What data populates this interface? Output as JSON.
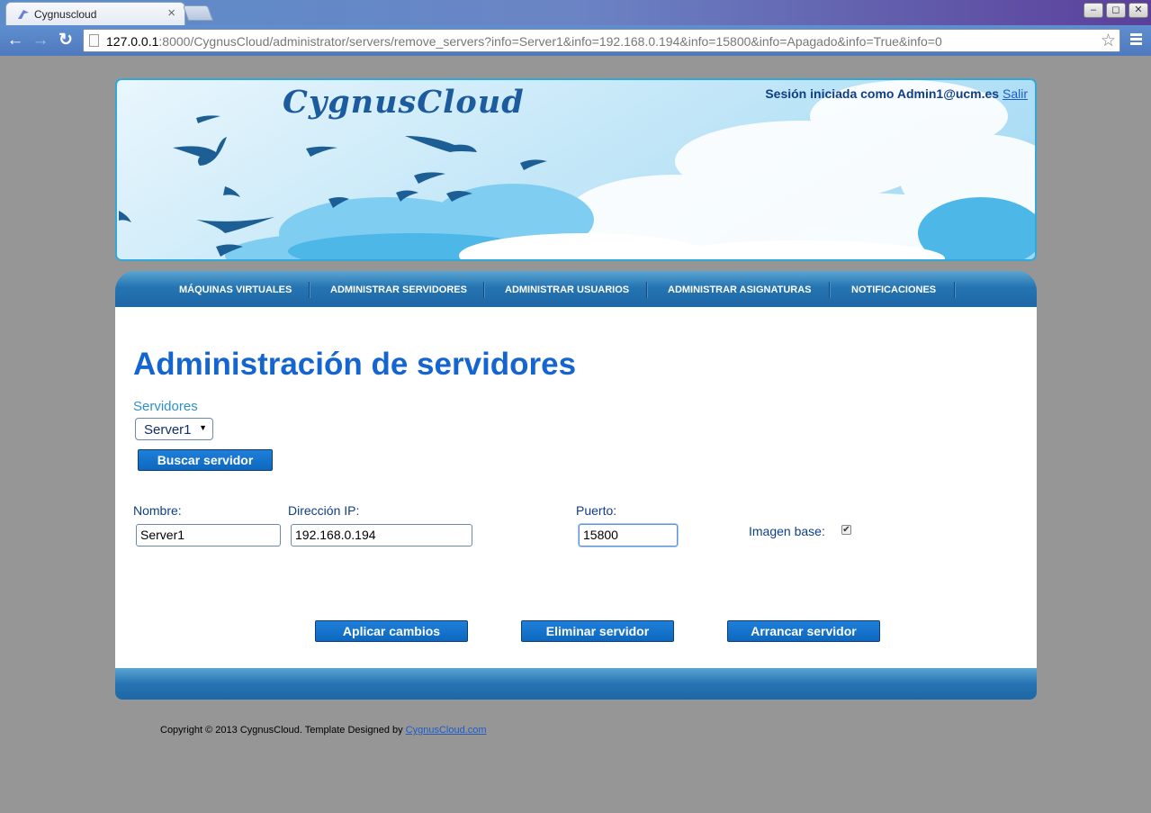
{
  "browser": {
    "tab_title": "Cygnuscloud",
    "tab_close": "×",
    "url_host": "127.0.0.1",
    "url_rest": ":8000/CygnusCloud/administrator/servers/remove_servers?info=Server1&info=192.168.0.194&info=15800&info=Apagado&info=True&info=0",
    "window_buttons": [
      "–",
      "◻",
      "✕"
    ]
  },
  "header": {
    "logo_text": "CygnusCloud",
    "session_prefix": "Sesión iniciada como Admin1@ucm.es",
    "logout_link": "Salir"
  },
  "nav": {
    "items": [
      {
        "label": "MÁQUINAS VIRTUALES"
      },
      {
        "label": "ADMINISTRAR SERVIDORES"
      },
      {
        "label": "ADMINISTRAR USUARIOS"
      },
      {
        "label": "ADMINISTRAR ASIGNATURAS"
      },
      {
        "label": "NOTIFICACIONES"
      }
    ]
  },
  "main": {
    "title": "Administración de servidores",
    "servers_label": "Servidores",
    "server_select_value": "Server1",
    "search_button": "Buscar servidor",
    "form": {
      "name_label": "Nombre:",
      "name_value": "Server1",
      "ip_label": "Dirección IP:",
      "ip_value": "192.168.0.194",
      "port_label": "Puerto:",
      "port_value": "15800",
      "base_image_label": "Imagen base:",
      "base_image_checked": true
    },
    "actions": {
      "apply": "Aplicar cambios",
      "delete": "Eliminar servidor",
      "start": "Arrancar servidor"
    }
  },
  "footer": {
    "copyright": "Copyright © 2013 CygnusCloud. Template Designed by",
    "link": "CygnusCloud.com"
  },
  "colors": {
    "accent": "#1565d0",
    "nav_bar": "#2574b1",
    "button": "#1272cd",
    "page_background": "#969696"
  }
}
